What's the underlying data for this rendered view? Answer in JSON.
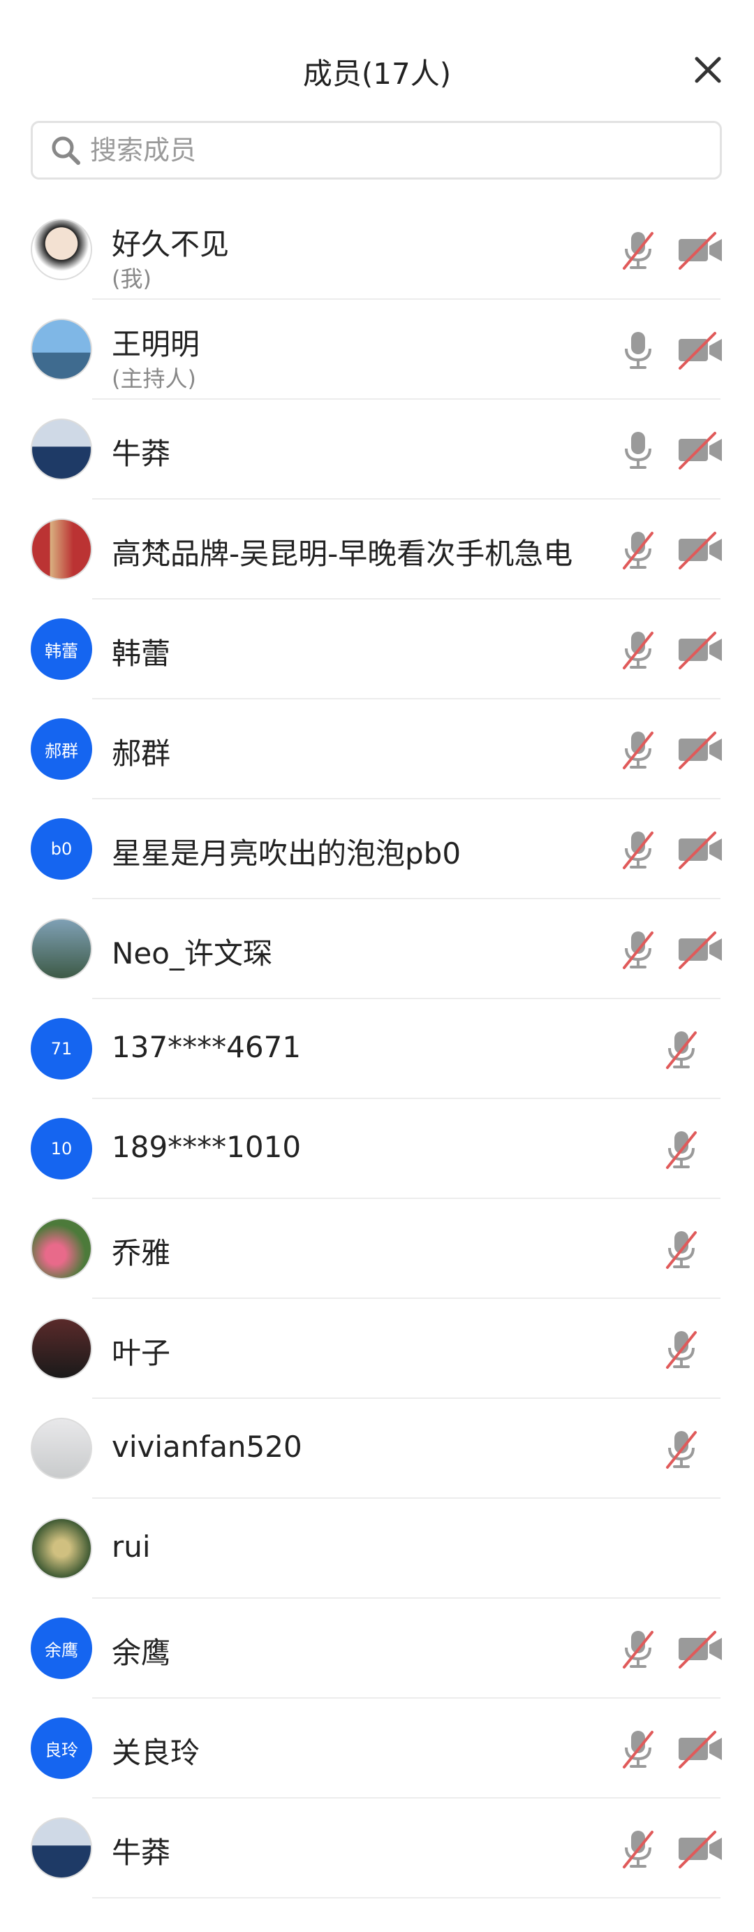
{
  "header": {
    "title": "成员(17人)"
  },
  "search": {
    "placeholder": "搜索成员"
  },
  "members": [
    {
      "name": "好久不见",
      "sub": "(我)",
      "avatar": "photo-face",
      "mic": "muted",
      "cam": "off"
    },
    {
      "name": "王明明",
      "sub": "(主持人)",
      "avatar": "photo-scene",
      "mic": "on",
      "cam": "off"
    },
    {
      "name": "牛莽",
      "sub": "",
      "avatar": "photo-man",
      "mic": "on",
      "cam": "off"
    },
    {
      "name": "高梵品牌-吴昆明-早晚看次手机急电",
      "sub": "",
      "avatar": "photo-group",
      "mic": "muted",
      "cam": "off"
    },
    {
      "name": "韩蕾",
      "sub": "",
      "avatar_text": "韩蕾",
      "mic": "muted",
      "cam": "off"
    },
    {
      "name": "郝群",
      "sub": "",
      "avatar_text": "郝群",
      "mic": "muted",
      "cam": "off"
    },
    {
      "name": "星星是月亮吹出的泡泡pb0",
      "sub": "",
      "avatar_text": "b0",
      "mic": "muted",
      "cam": "off"
    },
    {
      "name": "Neo_许文琛",
      "sub": "",
      "avatar": "photo-person",
      "mic": "muted",
      "cam": "off"
    },
    {
      "name": "137****4671",
      "sub": "",
      "avatar_text": "71",
      "mic": "muted",
      "cam": "none"
    },
    {
      "name": "189****1010",
      "sub": "",
      "avatar_text": "10",
      "mic": "muted",
      "cam": "none"
    },
    {
      "name": "乔雅",
      "sub": "",
      "avatar": "photo-flowers",
      "mic": "muted",
      "cam": "none"
    },
    {
      "name": "叶子",
      "sub": "",
      "avatar": "photo-woman",
      "mic": "muted",
      "cam": "none"
    },
    {
      "name": "vivianfan520",
      "sub": "",
      "avatar": "photo-fog",
      "mic": "muted",
      "cam": "none"
    },
    {
      "name": "rui",
      "sub": "",
      "avatar": "photo-garden",
      "mic": "none",
      "cam": "none"
    },
    {
      "name": "余鹰",
      "sub": "",
      "avatar_text": "余鹰",
      "mic": "muted",
      "cam": "off"
    },
    {
      "name": "关良玲",
      "sub": "",
      "avatar_text": "良玲",
      "mic": "muted",
      "cam": "off"
    },
    {
      "name": "牛莽",
      "sub": "",
      "avatar": "photo-man",
      "mic": "muted",
      "cam": "off"
    }
  ],
  "colors": {
    "accent": "#1565f0",
    "muted_red": "#e05a5a",
    "icon_gray": "#9a9a9a"
  }
}
